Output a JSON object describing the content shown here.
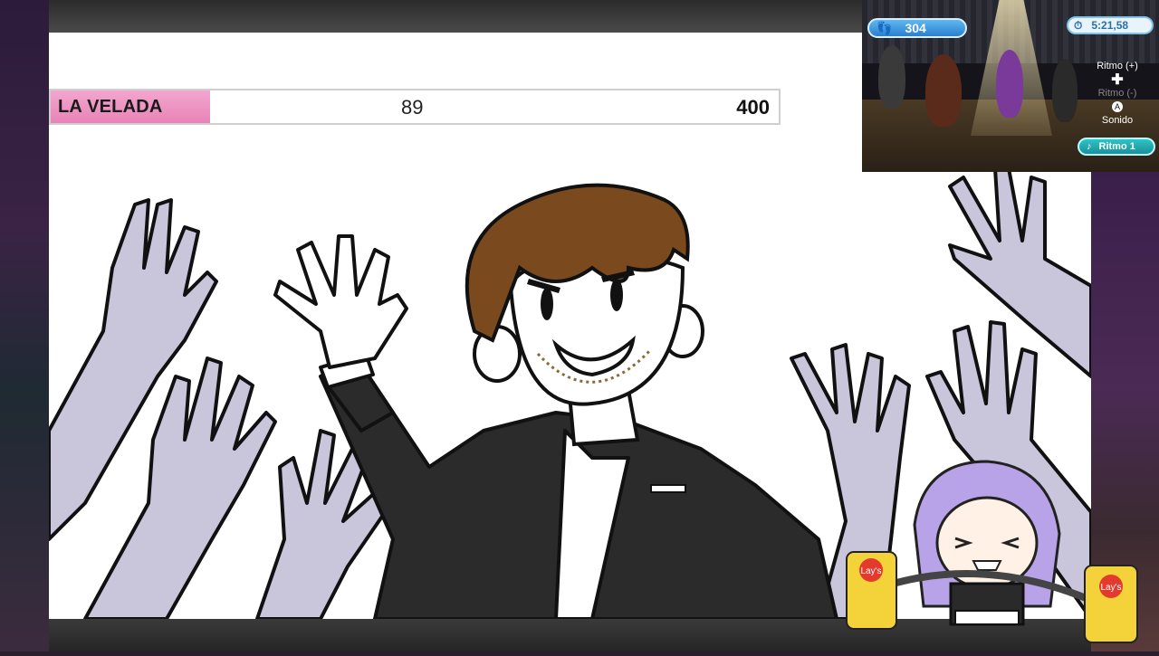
{
  "score_bar": {
    "label": "LA VELADA",
    "current": "89",
    "goal": "400",
    "progress_fraction": 0.2225
  },
  "game_hud": {
    "score": "304",
    "timer": "5:21,58",
    "controls": {
      "rhythm_up": "Ritmo (+)",
      "rhythm_down": "Ritmo (-)",
      "a_button": "A",
      "sound": "Sonido"
    },
    "rhythm_pill": "Ritmo 1"
  },
  "overlay": {
    "chips_brand": "Lay's"
  },
  "icons": [
    "footprint-icon",
    "clock-icon",
    "dpad-icon",
    "a-button-icon",
    "music-note-icon"
  ],
  "colors": {
    "score_tag": "#e784b7",
    "hud_blue": "#2b7fcf",
    "hud_teal": "#1a8f9a",
    "hand_gray": "#c9c6dc",
    "hair_brown": "#7a4a1e",
    "suit_black": "#2b2b2b"
  }
}
